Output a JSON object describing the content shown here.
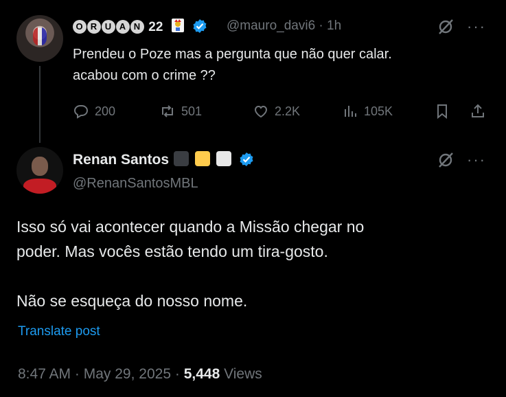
{
  "reply": {
    "display_name_suffix": "22",
    "name_circles": [
      "O",
      "R",
      "U",
      "A",
      "N"
    ],
    "handle": "@mauro_davi6",
    "time": "· 1h",
    "text_line1": "Prendeu o Poze mas a pergunta que não quer calar.",
    "text_line2": "acabou com o crime ??",
    "actions": {
      "replies": "200",
      "reposts": "501",
      "likes": "2.2K",
      "views": "105K"
    }
  },
  "main": {
    "display_name": "Renan Santos",
    "name_squares": [
      "#3a3d42",
      "#ffcc4d",
      "#e7e7e7"
    ],
    "handle": "@RenanSantosMBL",
    "text_line1": "Isso só vai acontecer quando a Missão chegar no",
    "text_line2": "poder. Mas vocês estão tendo um tira-gosto.",
    "text_line3": "Não se esqueça do nosso nome.",
    "translate_label": "Translate post",
    "time": "8:47 AM",
    "date": "May 29, 2025",
    "separator": "·",
    "views_count": "5,448",
    "views_label": "Views"
  },
  "colors": {
    "background": "#000000",
    "text": "#e7e9ea",
    "muted": "#71767b",
    "accent": "#1d9bf0"
  },
  "icons": [
    "grok-icon",
    "more-icon",
    "reply-icon",
    "repost-icon",
    "like-icon",
    "views-icon",
    "bookmark-icon",
    "share-icon",
    "verified-badge-icon"
  ]
}
